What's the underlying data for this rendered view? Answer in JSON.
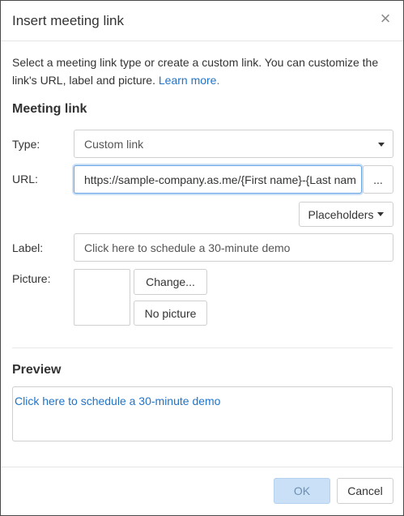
{
  "dialog": {
    "title": "Insert meeting link",
    "close_glyph": "×"
  },
  "intro": {
    "text": "Select a meeting link type or create a custom link. You can customize the link's URL, label and picture.",
    "learn_more": "Learn more."
  },
  "meeting_link": {
    "section_title": "Meeting link",
    "type_label": "Type:",
    "type_value": "Custom link",
    "url_label": "URL:",
    "url_value": "https://sample-company.as.me/{First name}-{Last nam",
    "url_more_button": "...",
    "placeholders_button": "Placeholders",
    "label_label": "Label:",
    "label_value": "Click here to schedule a 30-minute demo",
    "picture_label": "Picture:",
    "change_button": "Change...",
    "no_picture_button": "No picture"
  },
  "preview": {
    "section_title": "Preview",
    "link_text": "Click here to schedule a 30-minute demo"
  },
  "footer": {
    "ok_button": "OK",
    "cancel_button": "Cancel"
  },
  "colors": {
    "link": "#1f74c8",
    "ok_disabled_bg": "#c9e0f6",
    "focus_border": "#6aa7e6"
  }
}
